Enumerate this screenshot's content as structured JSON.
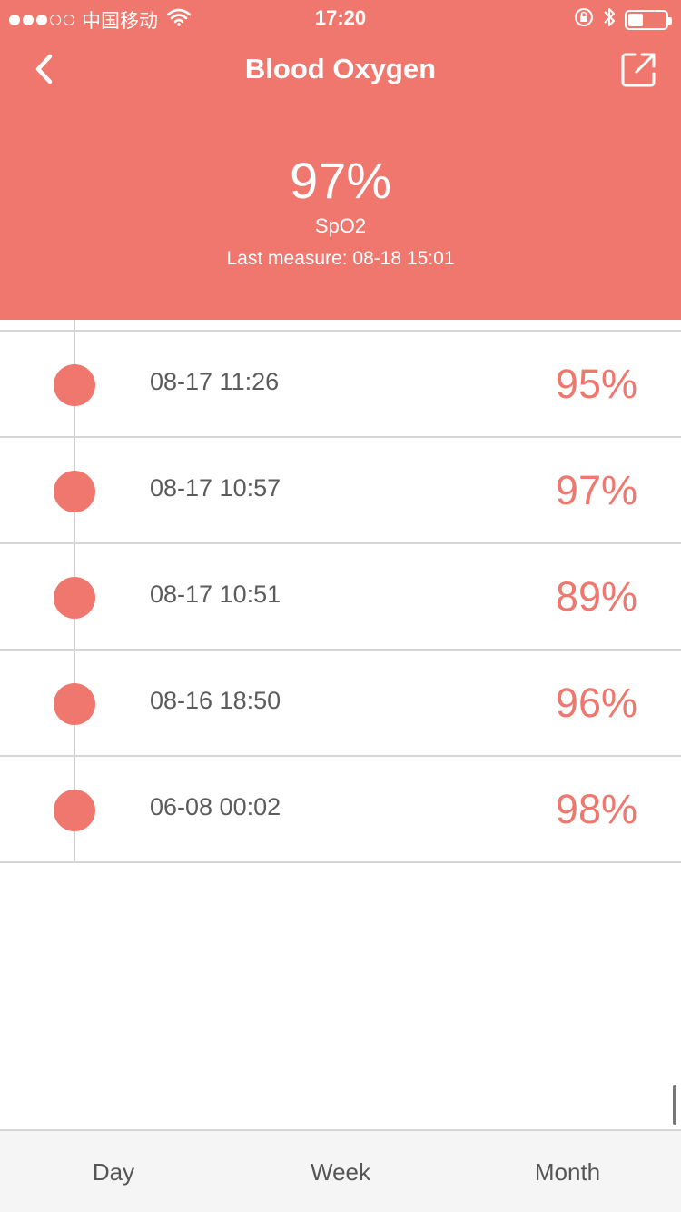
{
  "status_bar": {
    "carrier": "中国移动",
    "time": "17:20",
    "signal_full": 3,
    "signal_empty": 2,
    "battery_level_percent": 40
  },
  "nav": {
    "title": "Blood Oxygen"
  },
  "summary": {
    "value": "97%",
    "label": "SpO2",
    "last_measure": "Last measure: 08-18 15:01"
  },
  "records": [
    {
      "time": "08-17 11:26",
      "value": "95%"
    },
    {
      "time": "08-17 10:57",
      "value": "97%"
    },
    {
      "time": "08-17 10:51",
      "value": "89%"
    },
    {
      "time": "08-16 18:50",
      "value": "96%"
    },
    {
      "time": "06-08 00:02",
      "value": "98%"
    }
  ],
  "tabs": [
    {
      "label": "Day"
    },
    {
      "label": "Week"
    },
    {
      "label": "Month"
    }
  ],
  "colors": {
    "accent": "#f0776d",
    "text_gray": "#5b5b5b",
    "divider": "#d6d6d6"
  },
  "icons": {
    "back": "chevron-left-icon",
    "share": "share-icon",
    "wifi": "wifi-icon",
    "lock": "orientation-lock-icon",
    "bluetooth": "bluetooth-icon",
    "battery": "battery-icon"
  }
}
